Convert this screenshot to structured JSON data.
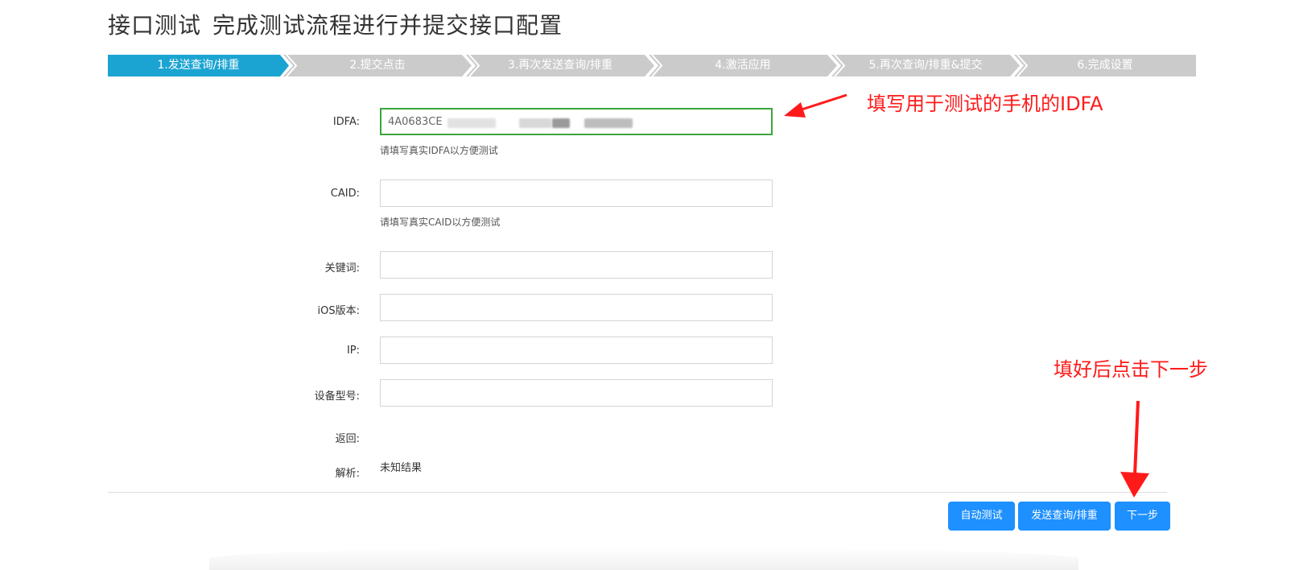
{
  "header": {
    "title": "接口测试",
    "subtitle": "完成测试流程进行并提交接口配置"
  },
  "steps": [
    {
      "label": "1.发送查询/排重",
      "active": true
    },
    {
      "label": "2.提交点击",
      "active": false
    },
    {
      "label": "3.再次发送查询/排重",
      "active": false
    },
    {
      "label": "4.激活应用",
      "active": false
    },
    {
      "label": "5.再次查询/排重&提交",
      "active": false
    },
    {
      "label": "6.完成设置",
      "active": false
    }
  ],
  "form": {
    "idfa": {
      "label": "IDFA:",
      "value": "4A0683CE",
      "hint": "请填写真实IDFA以方便测试"
    },
    "caid": {
      "label": "CAID:",
      "value": "",
      "hint": "请填写真实CAID以方便测试"
    },
    "keyword": {
      "label": "关键词:",
      "value": ""
    },
    "ios_version": {
      "label": "iOS版本:",
      "value": ""
    },
    "ip": {
      "label": "IP:",
      "value": ""
    },
    "device_model": {
      "label": "设备型号:",
      "value": ""
    },
    "response": {
      "label": "返回:",
      "value": ""
    },
    "parse": {
      "label": "解析:",
      "value": "未知结果"
    }
  },
  "buttons": {
    "auto_test": "自动测试",
    "send_query": "发送查询/排重",
    "next": "下一步"
  },
  "annotations": {
    "idfa_note": "填写用于测试的手机的IDFA",
    "next_note": "填好后点击下一步"
  },
  "colors": {
    "active_step": "#1BA4D2",
    "inactive_step": "#CBCBCB",
    "button": "#1E90FF",
    "annotation": "#FF1A1A",
    "active_input_border": "#3AA63A"
  }
}
